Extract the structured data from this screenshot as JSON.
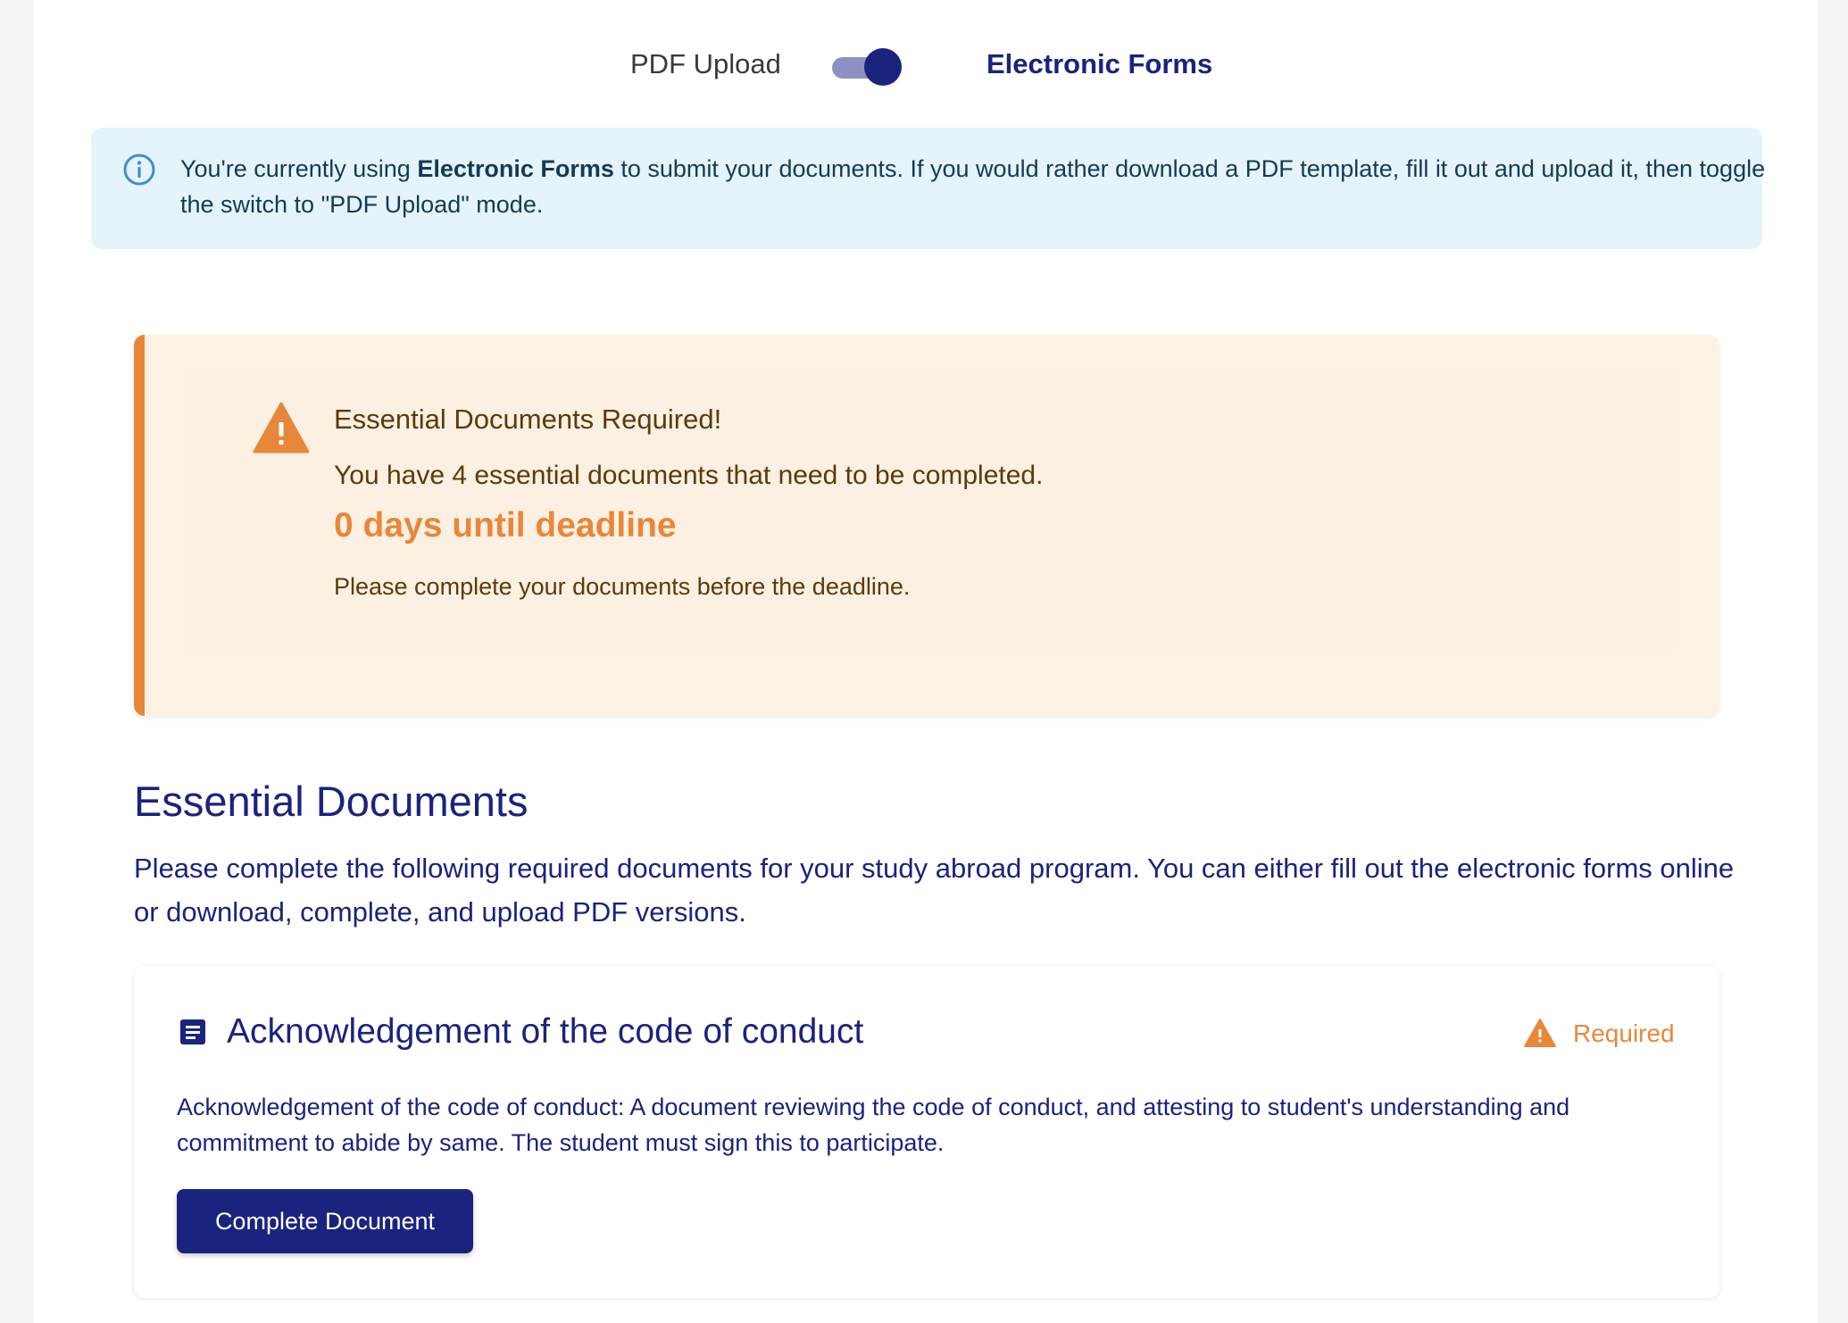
{
  "mode_toggle": {
    "left_label": "PDF Upload",
    "right_label": "Electronic Forms",
    "active": "Electronic Forms"
  },
  "info_banner": {
    "icon": "info-icon",
    "text_before": "You're currently using ",
    "text_bold": "Electronic Forms",
    "text_after": " to submit your documents. If you would rather download a PDF template, fill it out and upload it, then toggle the switch to \"PDF Upload\" mode."
  },
  "warning": {
    "icon": "warning-icon",
    "title": "Essential Documents Required!",
    "description": "You have 4 essential documents that need to be completed.",
    "deadline": "0 days until deadline",
    "note": "Please complete your documents before the deadline."
  },
  "section": {
    "title": "Essential Documents",
    "description": "Please complete the following required documents for your study abroad program. You can either fill out the electronic forms online or download, complete, and upload PDF versions."
  },
  "documents": [
    {
      "icon": "document-icon",
      "title": "Acknowledgement of the code of conduct",
      "status": "Required",
      "status_icon": "warning-icon",
      "description": "Acknowledgement of the code of conduct: A document reviewing the code of conduct, and attesting to student's understanding and commitment to abide by same. The student must sign this to participate.",
      "button_label": "Complete Document"
    }
  ],
  "colors": {
    "primary": "#1a237e",
    "warning": "#e8873a",
    "info_bg": "#e5f4fb",
    "warning_bg": "#fcf2e3"
  }
}
